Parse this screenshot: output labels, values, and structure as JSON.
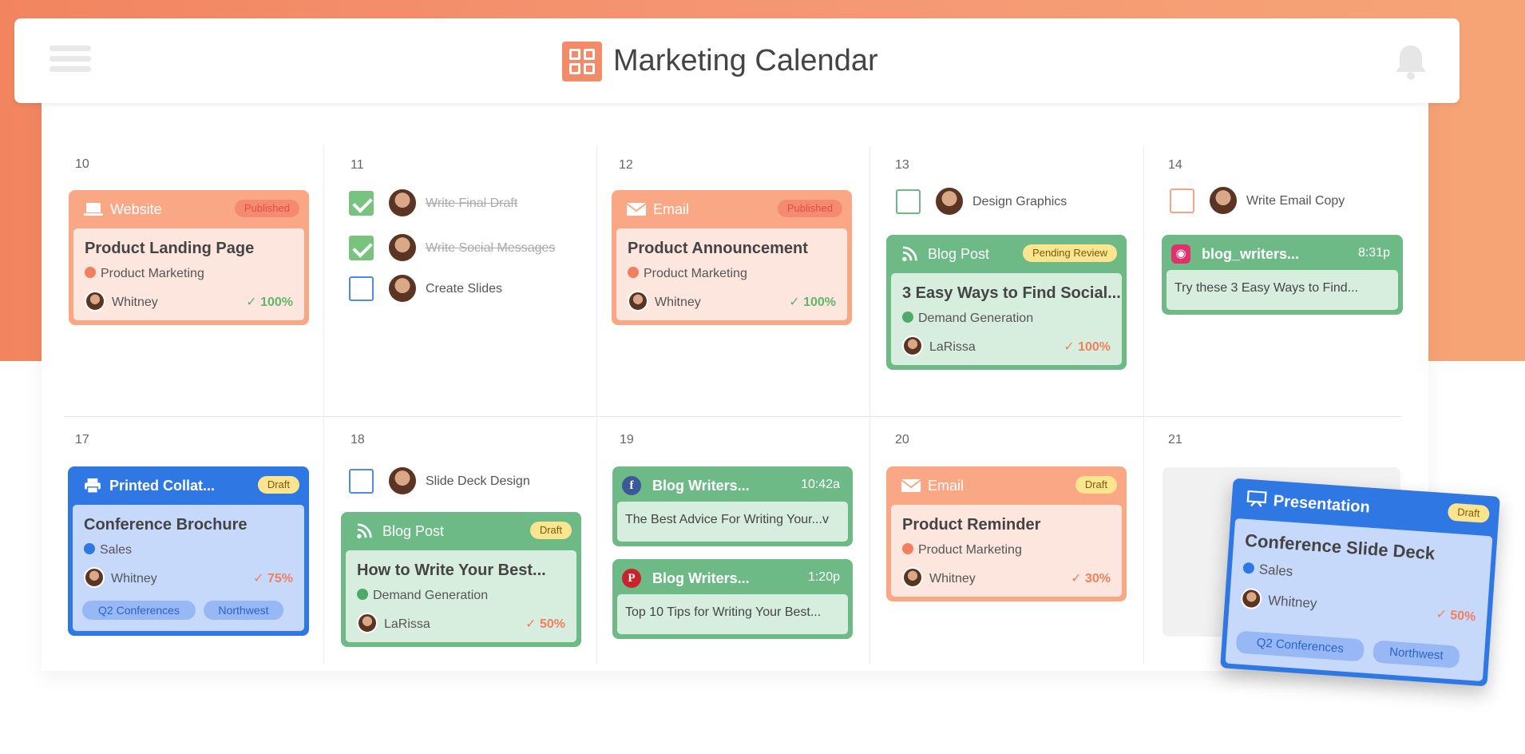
{
  "app": {
    "title": "Marketing Calendar"
  },
  "colors": {
    "orange": "#f38b68",
    "green": "#6dba86",
    "blue": "#2f78e4",
    "peach": "#fbe3d9",
    "mint": "#d7eedf",
    "lightblue": "#c6d9fb"
  },
  "days": [
    "10",
    "11",
    "12",
    "13",
    "14",
    "17",
    "18",
    "19",
    "20",
    "21"
  ],
  "cards": {
    "website": {
      "type": "Website",
      "status": "Published",
      "title": "Product Landing Page",
      "category": "Product Marketing",
      "owner": "Whitney",
      "progress": "100%"
    },
    "email1": {
      "type": "Email",
      "status": "Published",
      "title": "Product Announcement",
      "category": "Product Marketing",
      "owner": "Whitney",
      "progress": "100%"
    },
    "blog1": {
      "type": "Blog Post",
      "status": "Pending Review",
      "title": "3 Easy Ways to Find Social...",
      "category": "Demand Generation",
      "owner": "LaRissa",
      "progress": "100%"
    },
    "insta": {
      "account": "blog_writers...",
      "time": "8:31p",
      "text": "Try these 3 Easy Ways to Find..."
    },
    "printed": {
      "type": "Printed Collat...",
      "status": "Draft",
      "title": "Conference Brochure",
      "category": "Sales",
      "owner": "Whitney",
      "progress": "75%",
      "tags": [
        "Q2 Conferences",
        "Northwest"
      ]
    },
    "blog2": {
      "type": "Blog Post",
      "status": "Draft",
      "title": "How to Write Your Best...",
      "category": "Demand Generation",
      "owner": "LaRissa",
      "progress": "50%"
    },
    "facebook": {
      "account": "Blog Writers...",
      "time": "10:42a",
      "text": "The Best Advice For Writing Your...v"
    },
    "pinterest": {
      "account": "Blog Writers...",
      "time": "1:20p",
      "text": "Top 10 Tips for Writing Your Best..."
    },
    "email2": {
      "type": "Email",
      "status": "Draft",
      "title": "Product Reminder",
      "category": "Product Marketing",
      "owner": "Whitney",
      "progress": "30%"
    },
    "presentation": {
      "type": "Presentation",
      "status": "Draft",
      "title": "Conference Slide Deck",
      "category": "Sales",
      "owner": "Whitney",
      "progress": "50%",
      "tags": [
        "Q2 Conferences",
        "Northwest"
      ]
    }
  },
  "tasks": {
    "t1": {
      "label": "Write Final Draft",
      "done": true
    },
    "t2": {
      "label": "Write Social Messages",
      "done": true
    },
    "t3": {
      "label": "Create Slides",
      "done": false
    },
    "t4": {
      "label": "Design Graphics",
      "done": false
    },
    "t5": {
      "label": "Write Email Copy",
      "done": false
    },
    "t6": {
      "label": "Slide Deck Design",
      "done": false
    }
  },
  "icons": {
    "menu": "hamburger-icon",
    "logo": "calendar-grid-icon",
    "notifications": "bell-icon"
  }
}
